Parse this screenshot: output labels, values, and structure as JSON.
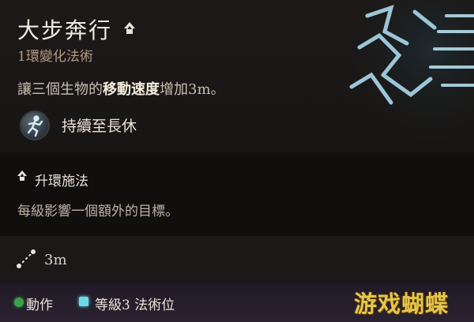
{
  "spell": {
    "title": "大步奔行",
    "subtitle": "1環變化法術",
    "description": {
      "before": "讓三個生物的",
      "highlight": "移動速度",
      "after": "增加3m。"
    },
    "duration": "持續至長休",
    "icons": {
      "title_badge": "upcast-chevron-icon",
      "duration": "running-figure-icon",
      "range": "range-icon"
    }
  },
  "upcast": {
    "label": "升環施法",
    "description": "每級影響一個額外的目標。"
  },
  "range": {
    "value": "3m"
  },
  "costs": {
    "action_label": "動作",
    "action_color": "#3da04a",
    "slot_label": "等級3 法術位",
    "slot_color": "#6fd9e8"
  },
  "watermark": "游戏蝴蝶",
  "colors": {
    "subtitle": "#b59a83",
    "watermark": "#e6c54a",
    "spell_art": "#a9d8ec"
  }
}
